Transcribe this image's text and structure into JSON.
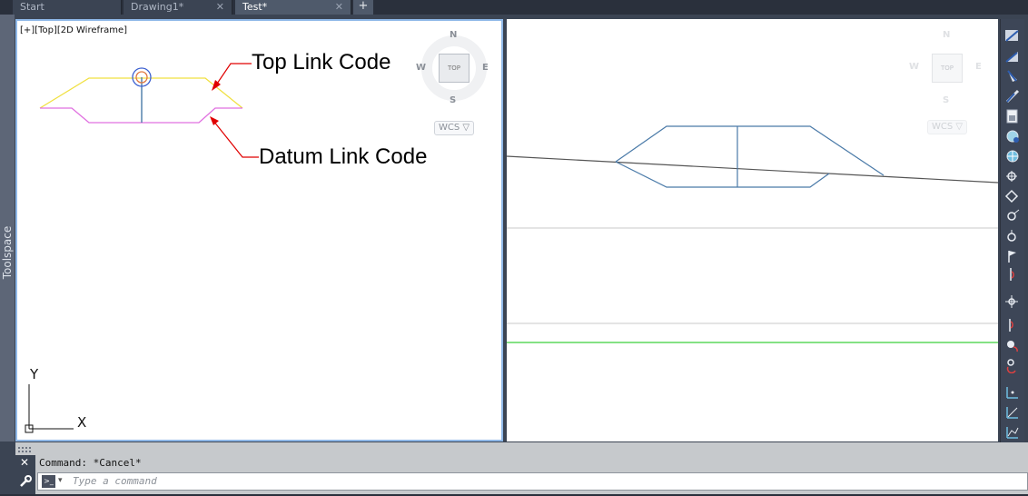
{
  "tabs": [
    {
      "label": "Start",
      "closable": false
    },
    {
      "label": "Drawing1*",
      "closable": true
    },
    {
      "label": "Test*",
      "closable": true,
      "active": true
    }
  ],
  "tab_add": "+",
  "tab_close": "✕",
  "toolspace_label": "Toolspace",
  "left_viewport": {
    "label": "[+][Top][2D Wireframe]",
    "viewcube": {
      "top": "TOP",
      "n": "N",
      "s": "S",
      "e": "E",
      "w": "W",
      "wcs": "WCS ▽"
    },
    "annotations": {
      "top": "Top Link Code",
      "datum": "Datum Link Code"
    },
    "ucs": {
      "x": "X",
      "y": "Y"
    }
  },
  "right_viewport": {
    "viewcube": {
      "top": "TOP",
      "n": "N",
      "s": "S",
      "e": "E",
      "w": "W",
      "wcs": "WCS ▽"
    }
  },
  "command": {
    "history": "Command: *Cancel*",
    "placeholder": "Type a command",
    "close": "✕"
  },
  "colors": {
    "top_link": "#f0e040",
    "datum_link": "#e070e0",
    "assembly": "#4a7aa8",
    "green_line": "#3ad13a"
  }
}
